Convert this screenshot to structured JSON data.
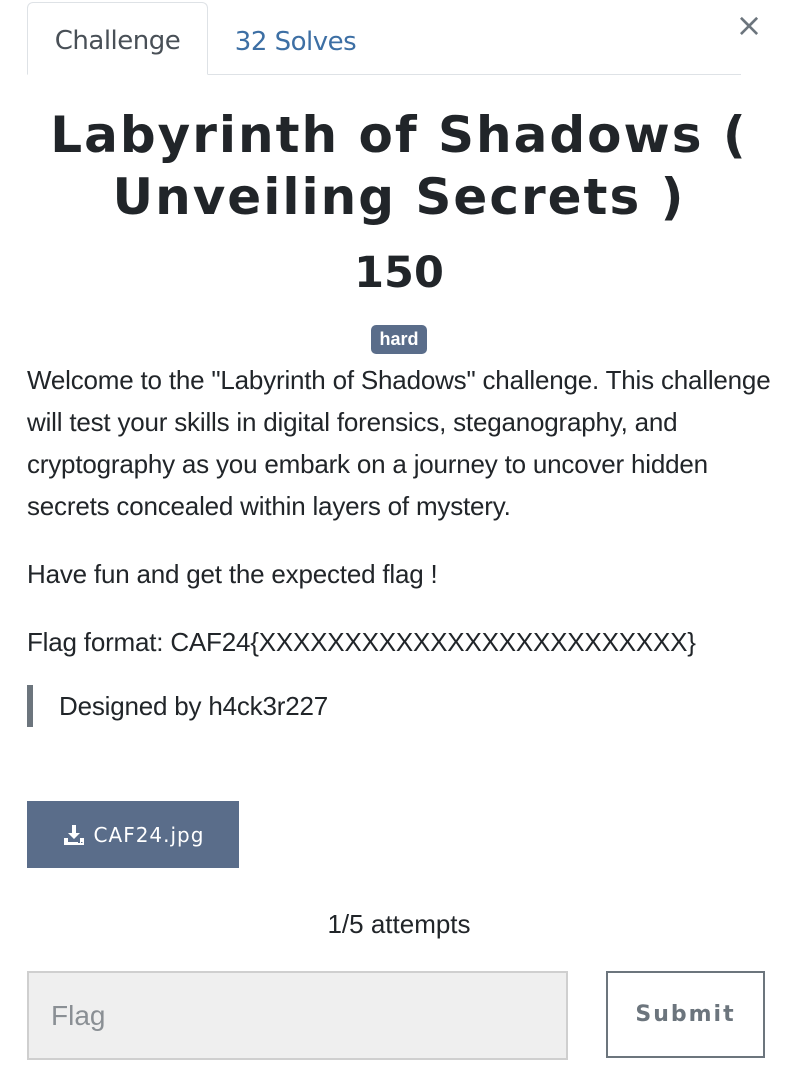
{
  "tabs": [
    {
      "label": "Challenge"
    },
    {
      "label": "32 Solves"
    }
  ],
  "close_icon": "×",
  "challenge": {
    "name": "Labyrinth of Shadows ( Unveiling Secrets )",
    "value": "150",
    "tag": "hard",
    "description": [
      "Welcome to the \"Labyrinth of Shadows\" challenge. This challenge will test your skills in digital forensics, steganography, and cryptography as you embark on a journey to uncover hidden secrets concealed within layers of mystery.",
      "Have fun and get the expected flag !",
      "Flag format: CAF24{XXXXXXXXXXXXXXXXXXXXXXXXX}"
    ],
    "designer": "Designed by h4ck3r227",
    "file": {
      "label": "CAF24.jpg",
      "icon": "download-icon"
    },
    "attempts": "1/5 attempts"
  },
  "submission": {
    "placeholder": "Flag",
    "submit_label": "Submit"
  },
  "colors": {
    "tab_link": "#3d6fa4",
    "badge": "#5a6d8a",
    "file_button": "#5a6d8a",
    "submit_border": "#6c757d"
  }
}
